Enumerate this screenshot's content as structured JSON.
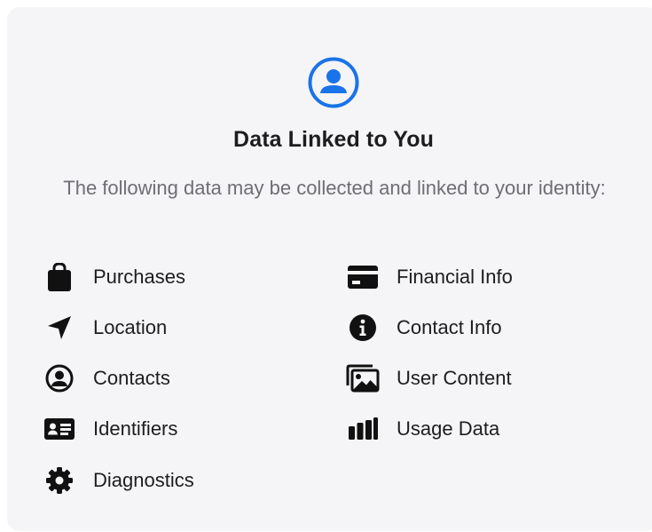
{
  "section": {
    "header_icon": "person-circle-icon",
    "title": "Data Linked to You",
    "subtitle": "The following data may be collected and linked to your identity:",
    "accent_color": "#1a73e8"
  },
  "left_column": [
    {
      "label": "Purchases",
      "icon": "shopping-bag-icon"
    },
    {
      "label": "Location",
      "icon": "location-arrow-icon"
    },
    {
      "label": "Contacts",
      "icon": "person-circle-icon"
    },
    {
      "label": "Identifiers",
      "icon": "id-card-icon"
    },
    {
      "label": "Diagnostics",
      "icon": "gear-icon"
    }
  ],
  "right_column": [
    {
      "label": "Financial Info",
      "icon": "credit-card-icon"
    },
    {
      "label": "Contact Info",
      "icon": "info-circle-icon"
    },
    {
      "label": "User Content",
      "icon": "photo-stack-icon"
    },
    {
      "label": "Usage Data",
      "icon": "bar-chart-icon"
    }
  ]
}
